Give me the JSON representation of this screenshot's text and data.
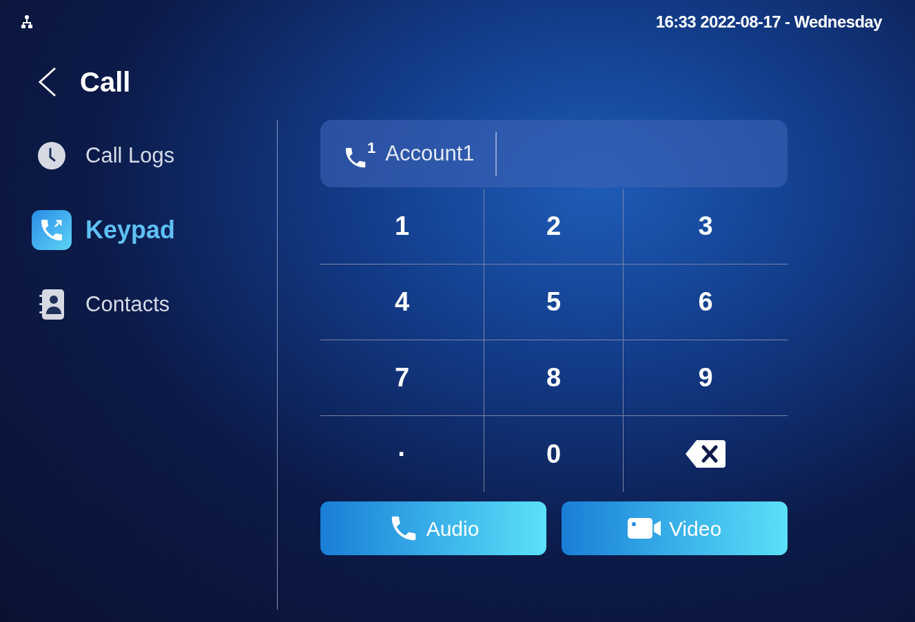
{
  "status_bar": {
    "datetime": "16:33  2022-08-17 - Wednesday"
  },
  "header": {
    "title": "Call"
  },
  "sidebar": {
    "items": [
      {
        "label": "Call Logs",
        "kind": "logs",
        "selected": false
      },
      {
        "label": "Keypad",
        "kind": "keypad",
        "selected": true
      },
      {
        "label": "Contacts",
        "kind": "contacts",
        "selected": false
      }
    ]
  },
  "account": {
    "index": "1",
    "name": "Account1"
  },
  "keypad": {
    "keys": [
      {
        "kind": "digit",
        "label": "1"
      },
      {
        "kind": "digit",
        "label": "2"
      },
      {
        "kind": "digit",
        "label": "3"
      },
      {
        "kind": "digit",
        "label": "4"
      },
      {
        "kind": "digit",
        "label": "5"
      },
      {
        "kind": "digit",
        "label": "6"
      },
      {
        "kind": "digit",
        "label": "7"
      },
      {
        "kind": "digit",
        "label": "8"
      },
      {
        "kind": "digit",
        "label": "9"
      },
      {
        "kind": "digit",
        "label": "·"
      },
      {
        "kind": "digit",
        "label": "0"
      },
      {
        "kind": "backspace"
      }
    ]
  },
  "buttons": [
    {
      "kind": "audio",
      "label": "Audio"
    },
    {
      "kind": "video",
      "label": "Video"
    }
  ]
}
